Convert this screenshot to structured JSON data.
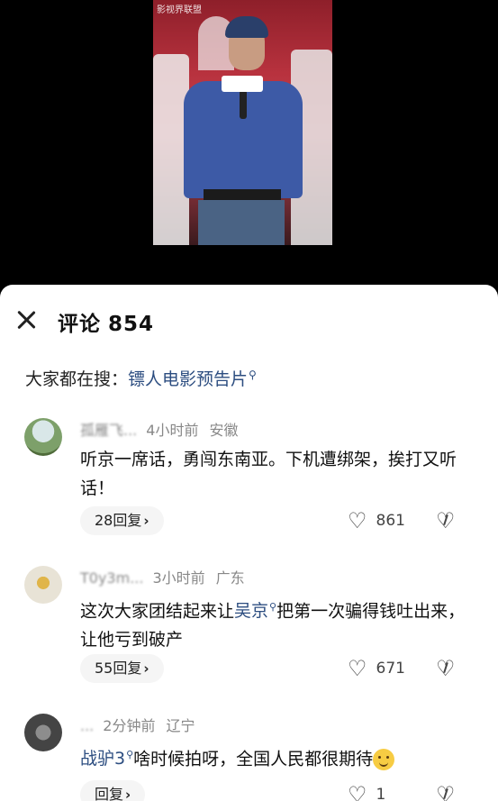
{
  "video": {
    "watermark": "影视界联盟"
  },
  "sheet": {
    "title_label": "评论",
    "title_count": "854",
    "trending_prefix": "大家都在搜：",
    "trending_term": "镖人电影预告片"
  },
  "comments": [
    {
      "username": "孤雁飞...",
      "time": "4小时前",
      "location": "安徽",
      "text": "听京一席话，勇闯东南亚。下机遭绑架，挨打又听话！",
      "replies": "28回复",
      "likes": "861"
    },
    {
      "username": "T0y3m...",
      "time": "3小时前",
      "location": "广东",
      "text_before": "这次大家团结起来让",
      "mention": "吴京",
      "text_after": "把第一次骗得钱吐出来，让他亏到破产",
      "replies": "55回复",
      "likes": "671"
    },
    {
      "username": "...",
      "time": "2分钟前",
      "location": "辽宁",
      "mention": "战驴3",
      "text_after": "啥时候拍呀，全国人民都很期待",
      "replies": "回复",
      "likes": "1"
    }
  ],
  "icons": {
    "close": "close-icon",
    "search": "search-icon",
    "heart": "heart-icon",
    "dislike": "dislike-icon",
    "chevron": "chevron-right-icon"
  }
}
